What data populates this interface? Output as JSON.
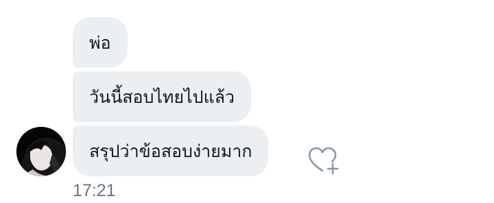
{
  "conversation": {
    "messages": [
      {
        "text": "พ่อ"
      },
      {
        "text": "วันนี้สอบไทยไปแล้ว"
      },
      {
        "text": "สรุปว่าข้อสอบง่ายมาก"
      }
    ],
    "timestamp": "17:21",
    "sender": {
      "avatar_icon": "user-avatar"
    },
    "reaction": {
      "icon": "heart-add-icon"
    }
  },
  "colors": {
    "bubble_background": "#eceff1",
    "bubble_text": "#14171a",
    "timestamp_text": "#657786",
    "icon_stroke": "#8899a6"
  }
}
